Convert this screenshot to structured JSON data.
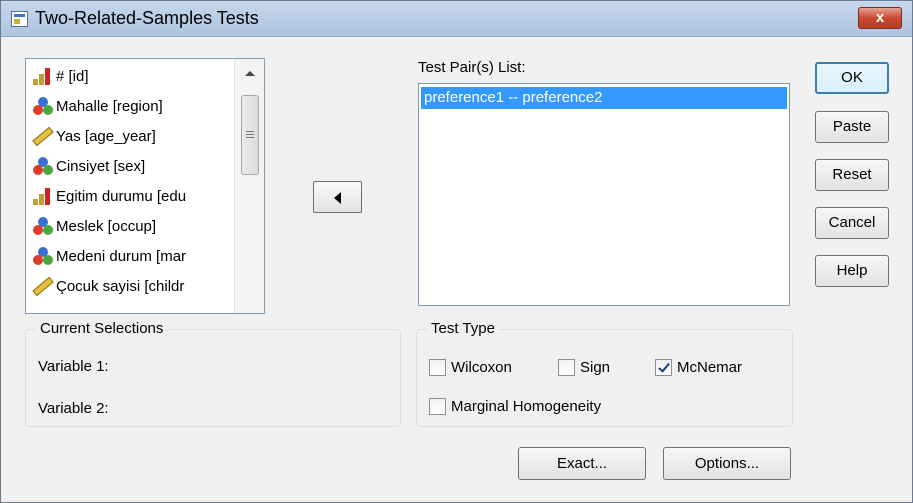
{
  "window": {
    "title": "Two-Related-Samples Tests",
    "close_label": "x"
  },
  "variables": [
    {
      "label": "# [id]",
      "icon": "ordinal-icon"
    },
    {
      "label": "Mahalle [region]",
      "icon": "nominal-icon"
    },
    {
      "label": "Yas [age_year]",
      "icon": "scale-icon"
    },
    {
      "label": "Cinsiyet [sex]",
      "icon": "nominal-icon"
    },
    {
      "label": "Egitim durumu [edu",
      "icon": "ordinal-icon"
    },
    {
      "label": "Meslek [occup]",
      "icon": "nominal-icon"
    },
    {
      "label": "Medeni durum [mar",
      "icon": "nominal-icon"
    },
    {
      "label": "Çocuk sayisi [childr",
      "icon": "scale-icon"
    }
  ],
  "pairs": {
    "label": "Test Pair(s) List:",
    "items": [
      "preference1 -- preference2"
    ]
  },
  "buttons": {
    "ok": "OK",
    "paste": "Paste",
    "reset": "Reset",
    "cancel": "Cancel",
    "help": "Help",
    "exact": "Exact...",
    "options": "Options..."
  },
  "current_selections": {
    "title": "Current Selections",
    "variable1": "Variable 1:",
    "variable2": "Variable 2:"
  },
  "test_type": {
    "title": "Test Type",
    "wilcoxon": {
      "label": "Wilcoxon",
      "checked": false
    },
    "sign": {
      "label": "Sign",
      "checked": false
    },
    "mcnemar": {
      "label": "McNemar",
      "checked": true
    },
    "marginal": {
      "label": "Marginal Homogeneity",
      "checked": false
    }
  }
}
